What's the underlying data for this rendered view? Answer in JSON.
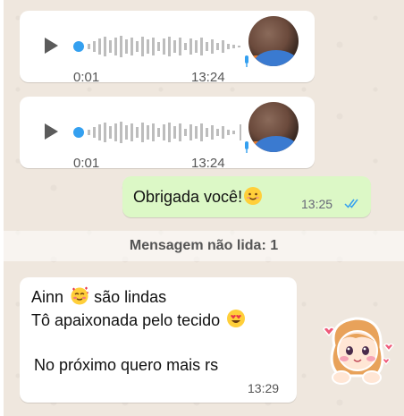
{
  "voice_messages": [
    {
      "duration": "0:01",
      "time": "13:24"
    },
    {
      "duration": "0:01",
      "time": "13:24"
    }
  ],
  "outgoing": {
    "text": "Obrigada você!",
    "emoji": "😊",
    "time": "13:25",
    "status": "read"
  },
  "unread_divider": "Mensagem não lida: 1",
  "incoming": {
    "line1_pre": "Ainn",
    "line1_emoji": "🥰",
    "line1_post": "são lindas",
    "line2": "Tô apaixonada pelo tecido",
    "line2_emoji": "😍",
    "line3": "No próximo quero mais rs",
    "time": "13:29"
  },
  "colors": {
    "outgoing_bubble": "#dcf8c6",
    "incoming_bubble": "#ffffff",
    "chat_background": "#efe7de",
    "read_ticks": "#34a0f0",
    "waveform": "#bdbdbd",
    "play_icon": "#5b5b5b"
  },
  "icons": [
    "play-icon",
    "mic-icon",
    "double-check-icon",
    "love-sticker"
  ]
}
